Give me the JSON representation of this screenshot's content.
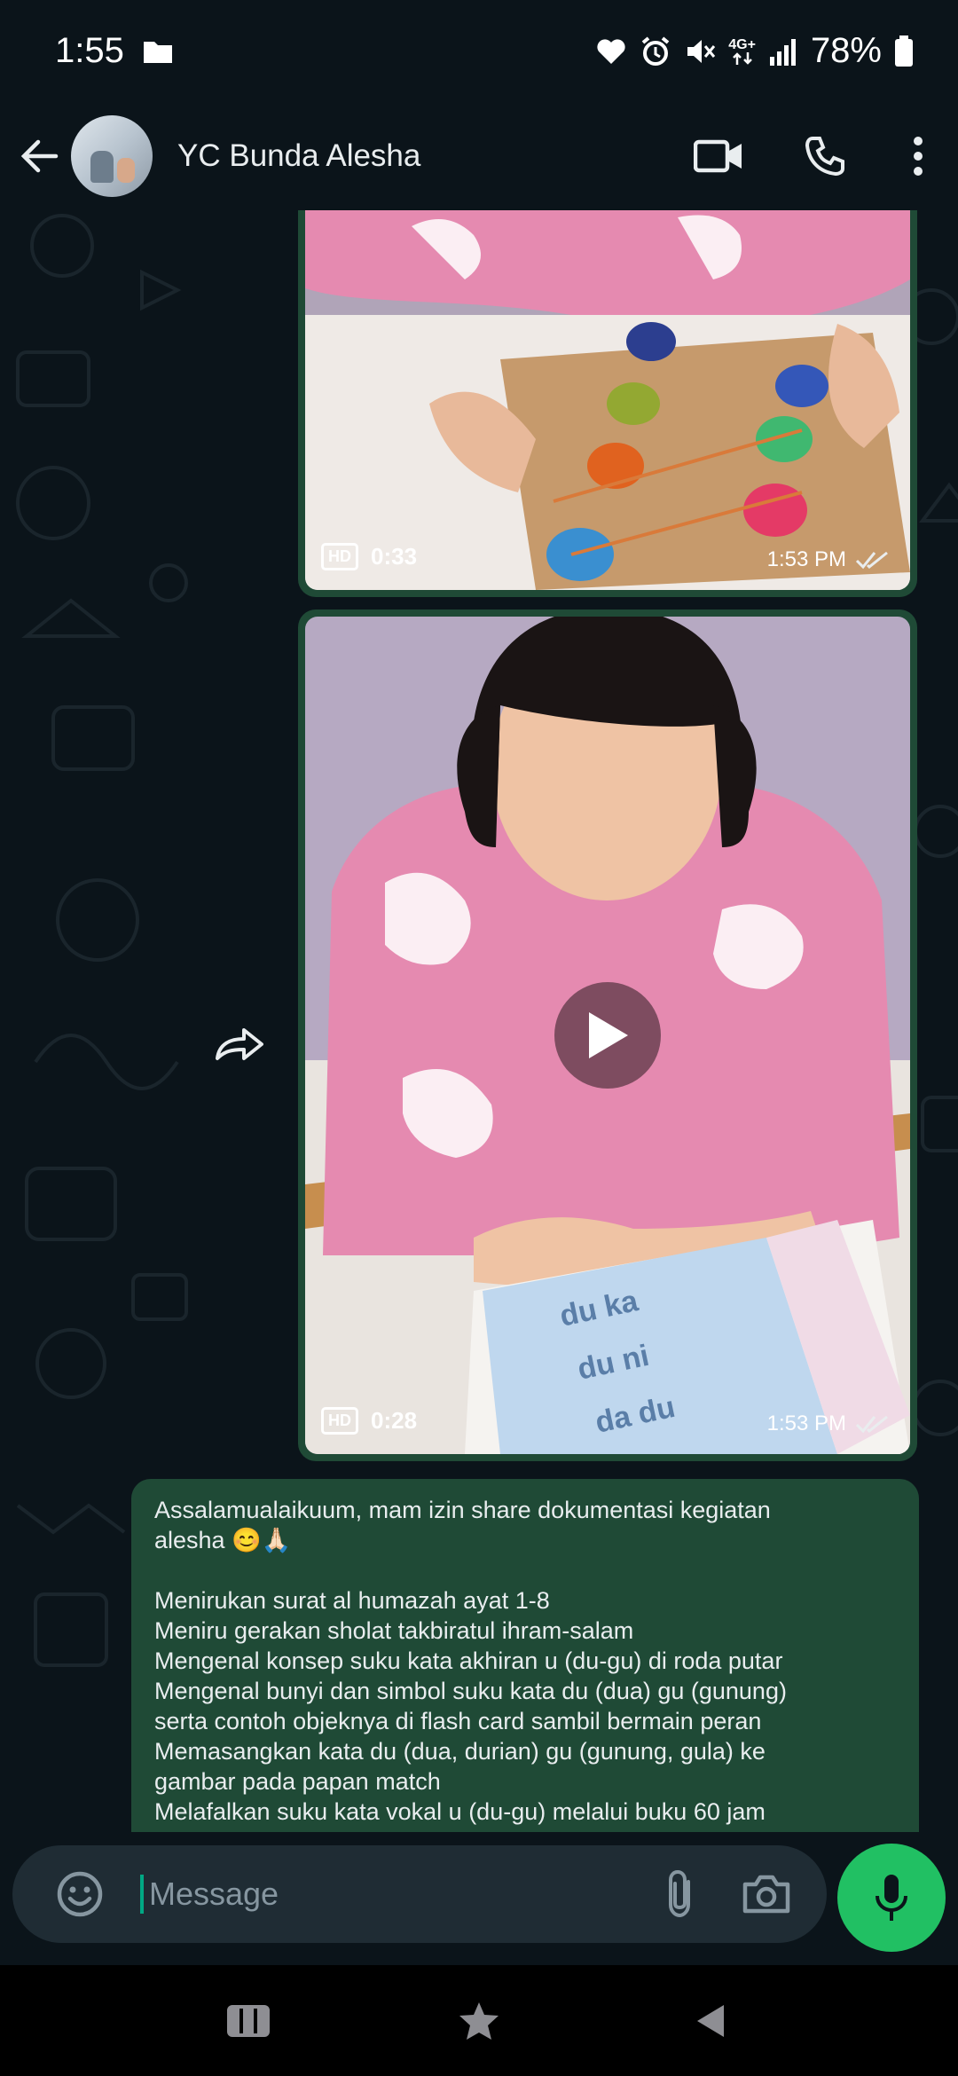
{
  "status_bar": {
    "time": "1:55",
    "battery": "78%",
    "network": "4G+",
    "icons": [
      "folder-icon",
      "heart-icon",
      "alarm-icon",
      "mute-icon",
      "network-icon",
      "signal-icon",
      "battery-icon"
    ]
  },
  "header": {
    "contact_name": "YC Bunda Alesha",
    "icons": [
      "back-arrow-icon",
      "avatar",
      "video-call-icon",
      "phone-icon",
      "more-icon"
    ]
  },
  "messages": [
    {
      "type": "video",
      "hd_label": "HD",
      "duration": "0:33",
      "time": "1:53 PM",
      "status": "read"
    },
    {
      "type": "video",
      "hd_label": "HD",
      "duration": "0:28",
      "time": "1:53 PM",
      "status": "read"
    },
    {
      "type": "text",
      "greeting_line1": "Assalamualaikuum, mam izin share dokumentasi kegiatan",
      "greeting_line2": "alesha 😊🙏🏻",
      "lines": [
        "Menirukan surat al humazah ayat 1-8",
        "Meniru gerakan sholat takbiratul ihram-salam",
        "Mengenal konsep suku kata akhiran u (du-gu) di roda putar",
        "Mengenal bunyi dan simbol suku kata du (dua) gu (gunung)",
        "serta contoh objeknya di flash card sambil bermain peran",
        "Memasangkan kata du (dua, durian) gu (gunung, gula) ke",
        "gambar pada papan match",
        "Melafalkan suku kata vokal u (du-gu) melalui buku 60 jam"
      ]
    }
  ],
  "input": {
    "placeholder": "Message"
  },
  "colors": {
    "background": "#0b141a",
    "bubble_outgoing": "#1f4a36",
    "accent": "#21c063",
    "input_bg": "#1f2c34",
    "read_tick": "#d1d7db"
  }
}
